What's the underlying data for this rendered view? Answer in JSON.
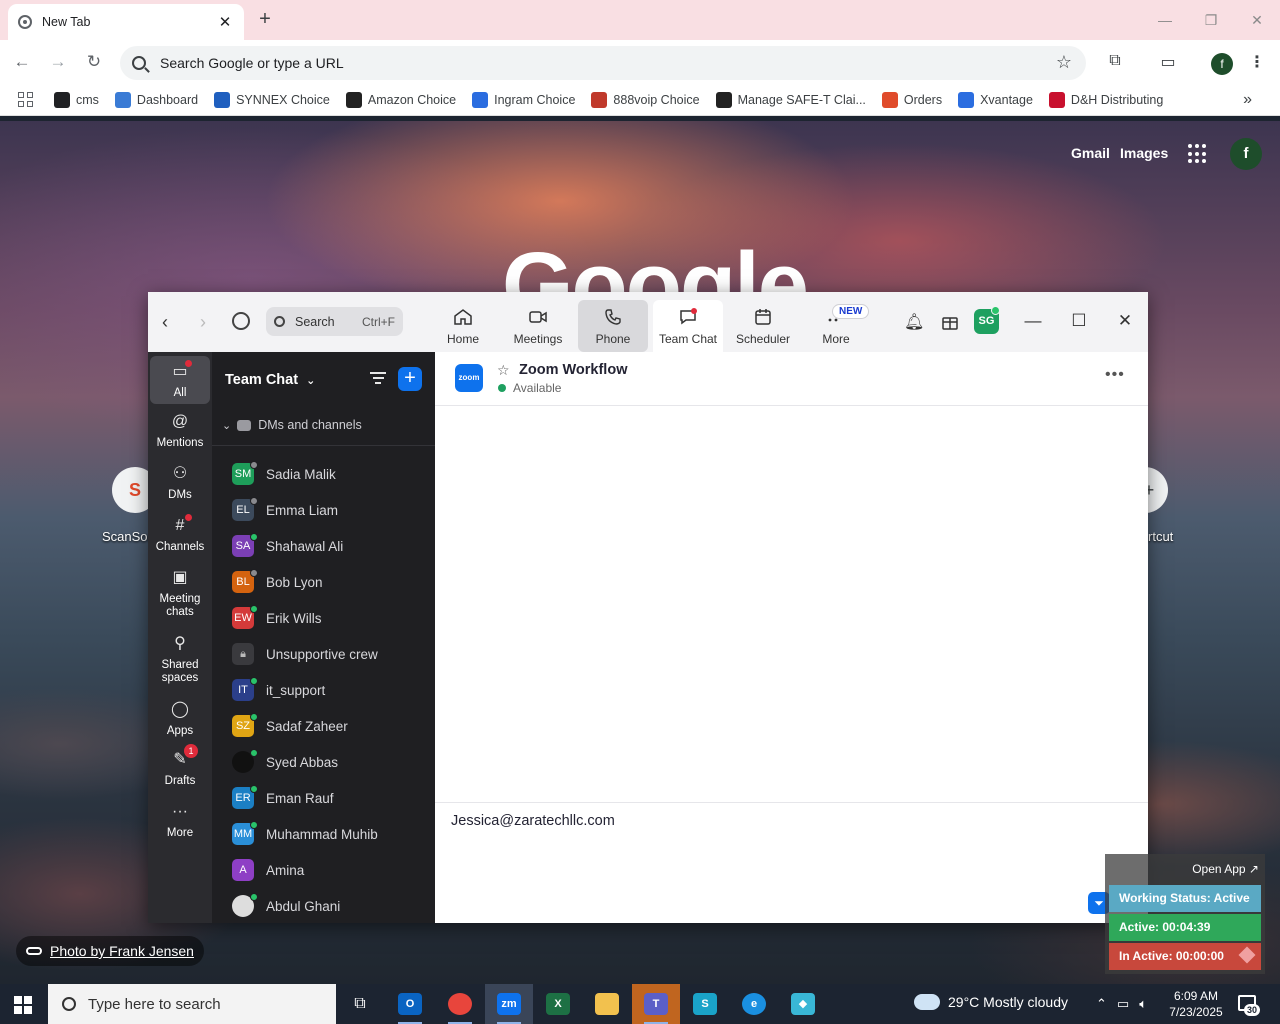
{
  "browser": {
    "tab_title": "New Tab",
    "omnibox_placeholder": "Search Google or type a URL",
    "profile_initial": "f",
    "bookmarks": [
      {
        "label": "cms",
        "color": "#202124"
      },
      {
        "label": "Dashboard",
        "color": "#3a7bd5"
      },
      {
        "label": "SYNNEX Choice",
        "color": "#1f5fbf"
      },
      {
        "label": "Amazon Choice",
        "color": "#222222"
      },
      {
        "label": "Ingram Choice",
        "color": "#2b6de0"
      },
      {
        "label": "888voip Choice",
        "color": "#c0392b"
      },
      {
        "label": "Manage SAFE-T Clai...",
        "color": "#222222"
      },
      {
        "label": "Orders",
        "color": "#e04b2b"
      },
      {
        "label": "Xvantage",
        "color": "#2b6de0"
      },
      {
        "label": "D&H Distributing",
        "color": "#c8102e"
      }
    ]
  },
  "ntp": {
    "gmail": "Gmail",
    "images": "Images",
    "avatar_initial": "f",
    "logo_text": "Google",
    "shortcut_left_label": "ScanSou",
    "shortcut_right_label": "rtcut",
    "photo_credit": "Photo by Frank Jensen"
  },
  "zoom": {
    "search_label": "Search",
    "search_shortcut": "Ctrl+F",
    "nav": [
      {
        "label": "Home",
        "icon": "home-icon"
      },
      {
        "label": "Meetings",
        "icon": "video-icon"
      },
      {
        "label": "Phone",
        "icon": "phone-icon"
      },
      {
        "label": "Team Chat",
        "icon": "chat-icon"
      },
      {
        "label": "Scheduler",
        "icon": "calendar-icon"
      },
      {
        "label": "More",
        "icon": "more-icon"
      }
    ],
    "new_badge": "NEW",
    "user_initials": "SG",
    "rail": [
      {
        "label": "All",
        "icon": "chat-bubble-icon"
      },
      {
        "label": "Mentions",
        "icon": "at-icon"
      },
      {
        "label": "DMs",
        "icon": "people-icon"
      },
      {
        "label": "Channels",
        "icon": "hash-icon"
      },
      {
        "label": "Meeting chats",
        "icon": "calendar-chat-icon"
      },
      {
        "label": "Shared spaces",
        "icon": "shared-spaces-icon"
      },
      {
        "label": "Apps",
        "icon": "apps-icon"
      },
      {
        "label": "Drafts",
        "icon": "drafts-icon",
        "badge": "1"
      },
      {
        "label": "More",
        "icon": "ellipsis-icon"
      }
    ],
    "list_title": "Team Chat",
    "section_title": "DMs and channels",
    "contacts": [
      {
        "initials": "SM",
        "name": "Sadia Malik",
        "color": "#1e9e5a",
        "status": "#8a8a8e"
      },
      {
        "initials": "EL",
        "name": "Emma Liam",
        "color": "#3c4a5c",
        "status": "#8a8a8e"
      },
      {
        "initials": "SA",
        "name": "Shahawal Ali",
        "color": "#7b3fb5",
        "status": "#29c36a"
      },
      {
        "initials": "BL",
        "name": "Bob Lyon",
        "color": "#d4630f",
        "status": "#8a8a8e"
      },
      {
        "initials": "EW",
        "name": "Erik Wills",
        "color": "#d43a3a",
        "status": "#29c36a"
      },
      {
        "initials": "",
        "name": "Unsupportive crew",
        "color": "#3a3a3e",
        "status": ""
      },
      {
        "initials": "IT",
        "name": "it_support",
        "color": "#2b3f8a",
        "status": "#29c36a"
      },
      {
        "initials": "SZ",
        "name": "Sadaf Zaheer",
        "color": "#e0a514",
        "status": "#29c36a"
      },
      {
        "initials": "",
        "name": "Syed Abbas",
        "color": "#111111",
        "status": "#29c36a"
      },
      {
        "initials": "ER",
        "name": "Eman Rauf",
        "color": "#1b7fc4",
        "status": "#29c36a"
      },
      {
        "initials": "MM",
        "name": "Muhammad Muhib",
        "color": "#2a8fd8",
        "status": "#29c36a"
      },
      {
        "initials": "A",
        "name": "Amina",
        "color": "#8e3fc5",
        "status": ""
      },
      {
        "initials": "",
        "name": "Abdul Ghani",
        "color": "#dddddd",
        "status": "#29c36a"
      }
    ],
    "chat": {
      "title": "Zoom Workflow",
      "status": "Available",
      "logo_text": "zoom",
      "composer_value": "Jessica@zaratechllc.com"
    }
  },
  "working_status": {
    "open_app": "Open App ↗",
    "status": "Working Status: Active",
    "active": "Active: 00:04:39",
    "inactive": "In Active: 00:00:00"
  },
  "taskbar": {
    "search_placeholder": "Type here to search",
    "weather": "29°C  Mostly cloudy",
    "time": "6:09 AM",
    "date": "7/23/2025",
    "notif_count": "30",
    "apps": [
      {
        "glyph": "O",
        "color": "#0a64c2",
        "name": "outlook-app"
      },
      {
        "glyph": "",
        "color": "#e8453c",
        "name": "chrome-app"
      },
      {
        "glyph": "zm",
        "color": "#0e72ed",
        "name": "zoom-app"
      },
      {
        "glyph": "X",
        "color": "#1d7044",
        "name": "excel-app"
      },
      {
        "glyph": "",
        "color": "#f2c14e",
        "name": "file-explorer-app"
      },
      {
        "glyph": "T",
        "color": "#5b5fc7",
        "name": "teams-app"
      },
      {
        "glyph": "S",
        "color": "#1aa3c8",
        "name": "sublime-app"
      },
      {
        "glyph": "e",
        "color": "#1a8fe0",
        "name": "edge-app"
      },
      {
        "glyph": "◆",
        "color": "#39b7d6",
        "name": "diamond-app"
      }
    ]
  }
}
